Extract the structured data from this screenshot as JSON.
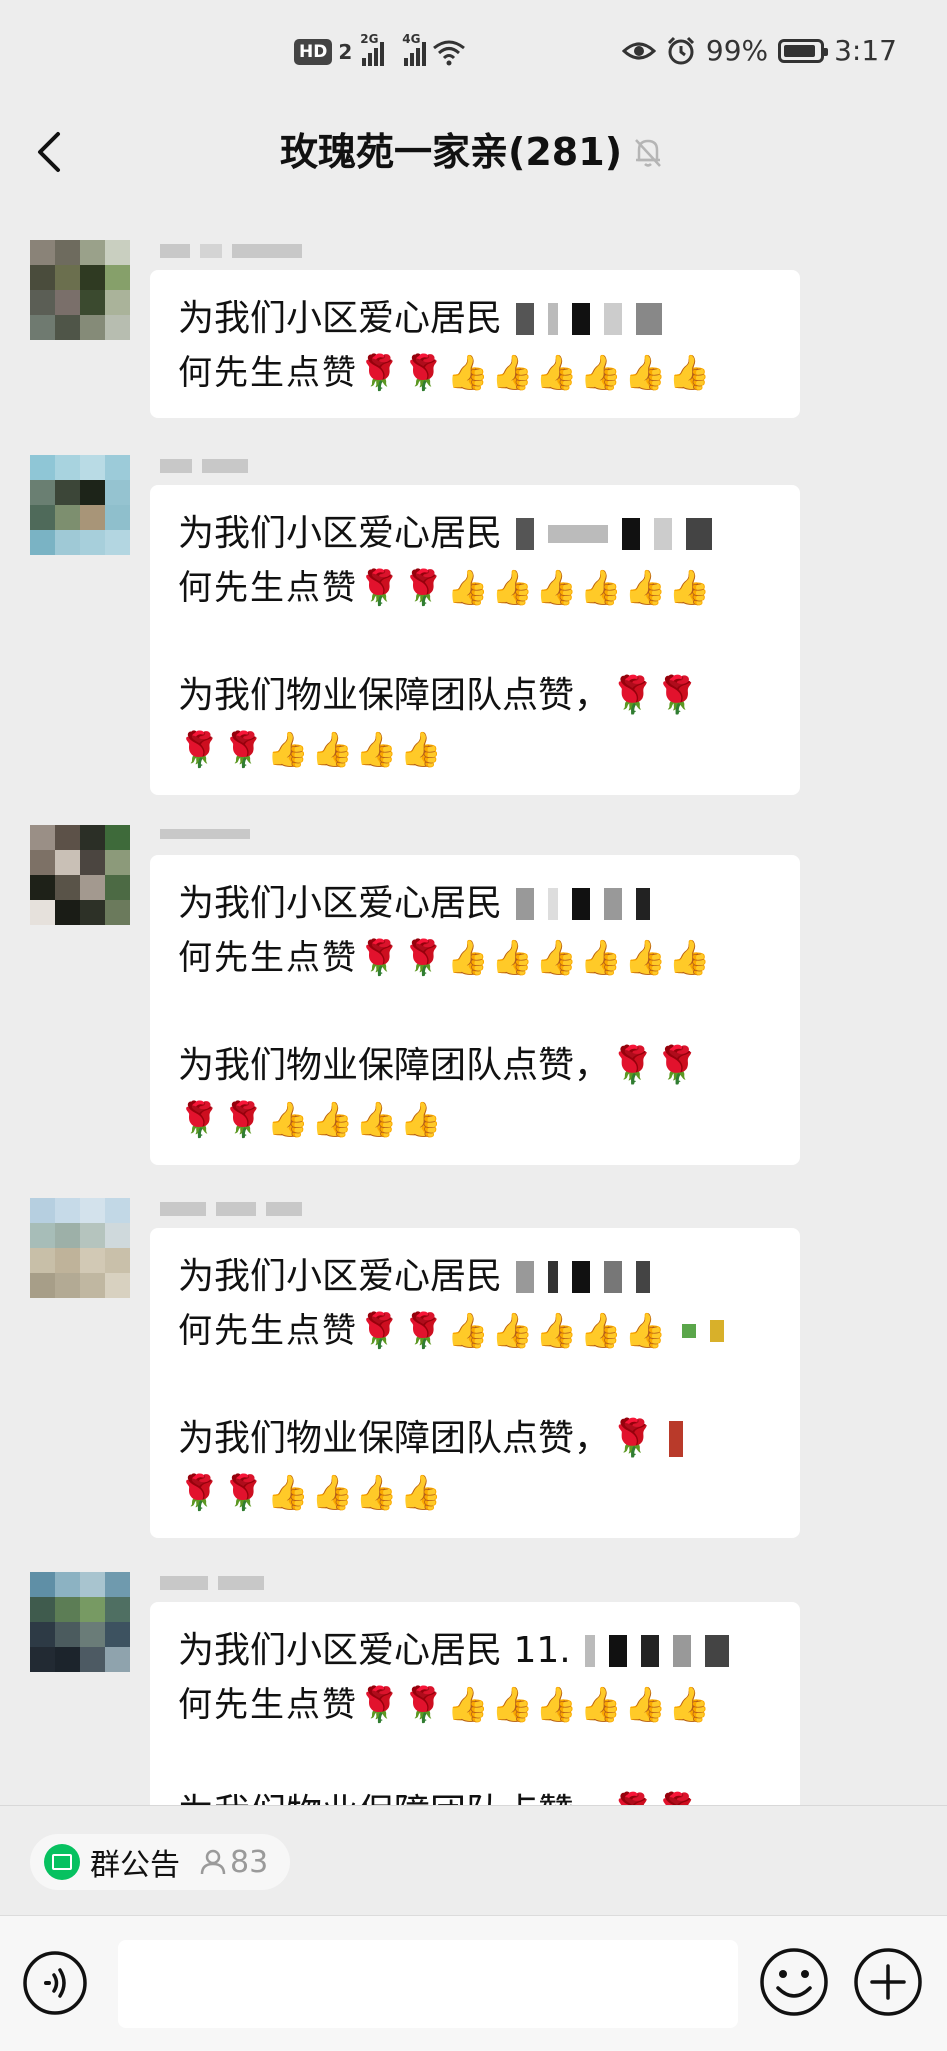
{
  "status_bar": {
    "hd": "HD",
    "sim": "2",
    "net1": "2G",
    "net2": "4G",
    "battery": "99%",
    "time": "3:17"
  },
  "header": {
    "title": "玫瑰苑一家亲(281)"
  },
  "messages": [
    {
      "line1": "为我们小区爱心居民",
      "line2": "何先生点赞🌹🌹👍👍👍👍👍👍"
    },
    {
      "line1": "为我们小区爱心居民",
      "line2": "何先生点赞🌹🌹👍👍👍👍👍👍",
      "line3": "为我们物业保障团队点赞，🌹🌹",
      "line4": "🌹🌹👍👍👍👍"
    },
    {
      "line1": "为我们小区爱心居民",
      "line2": "何先生点赞🌹🌹👍👍👍👍👍👍",
      "line3": "为我们物业保障团队点赞，🌹🌹",
      "line4": "🌹🌹👍👍👍👍"
    },
    {
      "line1": "为我们小区爱心居民",
      "line2": "何先生点赞🌹🌹👍👍👍👍👍",
      "line3": "为我们物业保障团队点赞，🌹",
      "line4": "🌹🌹👍👍👍👍"
    },
    {
      "line1": "为我们小区爱心居民 11.",
      "line2": "何先生点赞🌹🌹👍👍👍👍👍👍",
      "line3": "为我们物业保障团队点赞，🌹🌹"
    }
  ],
  "notice": {
    "label": "群公告",
    "count": "83"
  },
  "colors": {
    "background": "#ededed",
    "bubble": "#ffffff",
    "accent": "#07c160"
  },
  "icons": [
    "back-arrow-icon",
    "mute-bell-icon",
    "voice-icon",
    "emoji-icon",
    "plus-icon",
    "notice-icon",
    "person-icon",
    "eye-icon",
    "alarm-icon",
    "wifi-icon",
    "battery-icon"
  ]
}
